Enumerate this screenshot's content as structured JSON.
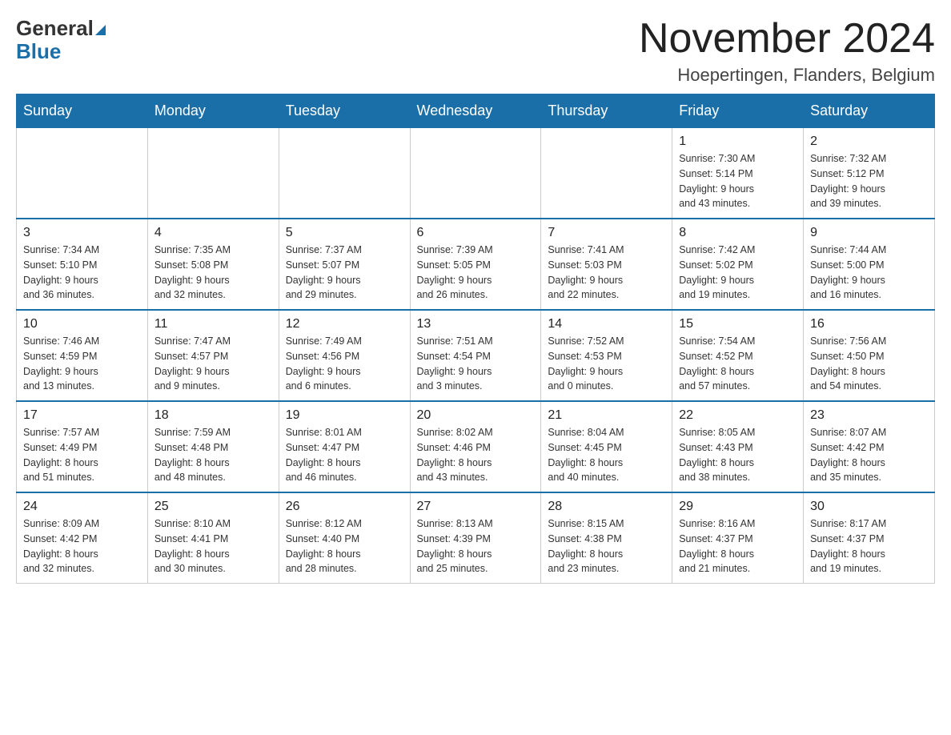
{
  "header": {
    "month_year": "November 2024",
    "location": "Hoepertingen, Flanders, Belgium",
    "logo_general": "General",
    "logo_blue": "Blue"
  },
  "days_of_week": [
    "Sunday",
    "Monday",
    "Tuesday",
    "Wednesday",
    "Thursday",
    "Friday",
    "Saturday"
  ],
  "weeks": [
    {
      "days": [
        {
          "num": "",
          "info": ""
        },
        {
          "num": "",
          "info": ""
        },
        {
          "num": "",
          "info": ""
        },
        {
          "num": "",
          "info": ""
        },
        {
          "num": "",
          "info": ""
        },
        {
          "num": "1",
          "info": "Sunrise: 7:30 AM\nSunset: 5:14 PM\nDaylight: 9 hours\nand 43 minutes."
        },
        {
          "num": "2",
          "info": "Sunrise: 7:32 AM\nSunset: 5:12 PM\nDaylight: 9 hours\nand 39 minutes."
        }
      ]
    },
    {
      "days": [
        {
          "num": "3",
          "info": "Sunrise: 7:34 AM\nSunset: 5:10 PM\nDaylight: 9 hours\nand 36 minutes."
        },
        {
          "num": "4",
          "info": "Sunrise: 7:35 AM\nSunset: 5:08 PM\nDaylight: 9 hours\nand 32 minutes."
        },
        {
          "num": "5",
          "info": "Sunrise: 7:37 AM\nSunset: 5:07 PM\nDaylight: 9 hours\nand 29 minutes."
        },
        {
          "num": "6",
          "info": "Sunrise: 7:39 AM\nSunset: 5:05 PM\nDaylight: 9 hours\nand 26 minutes."
        },
        {
          "num": "7",
          "info": "Sunrise: 7:41 AM\nSunset: 5:03 PM\nDaylight: 9 hours\nand 22 minutes."
        },
        {
          "num": "8",
          "info": "Sunrise: 7:42 AM\nSunset: 5:02 PM\nDaylight: 9 hours\nand 19 minutes."
        },
        {
          "num": "9",
          "info": "Sunrise: 7:44 AM\nSunset: 5:00 PM\nDaylight: 9 hours\nand 16 minutes."
        }
      ]
    },
    {
      "days": [
        {
          "num": "10",
          "info": "Sunrise: 7:46 AM\nSunset: 4:59 PM\nDaylight: 9 hours\nand 13 minutes."
        },
        {
          "num": "11",
          "info": "Sunrise: 7:47 AM\nSunset: 4:57 PM\nDaylight: 9 hours\nand 9 minutes."
        },
        {
          "num": "12",
          "info": "Sunrise: 7:49 AM\nSunset: 4:56 PM\nDaylight: 9 hours\nand 6 minutes."
        },
        {
          "num": "13",
          "info": "Sunrise: 7:51 AM\nSunset: 4:54 PM\nDaylight: 9 hours\nand 3 minutes."
        },
        {
          "num": "14",
          "info": "Sunrise: 7:52 AM\nSunset: 4:53 PM\nDaylight: 9 hours\nand 0 minutes."
        },
        {
          "num": "15",
          "info": "Sunrise: 7:54 AM\nSunset: 4:52 PM\nDaylight: 8 hours\nand 57 minutes."
        },
        {
          "num": "16",
          "info": "Sunrise: 7:56 AM\nSunset: 4:50 PM\nDaylight: 8 hours\nand 54 minutes."
        }
      ]
    },
    {
      "days": [
        {
          "num": "17",
          "info": "Sunrise: 7:57 AM\nSunset: 4:49 PM\nDaylight: 8 hours\nand 51 minutes."
        },
        {
          "num": "18",
          "info": "Sunrise: 7:59 AM\nSunset: 4:48 PM\nDaylight: 8 hours\nand 48 minutes."
        },
        {
          "num": "19",
          "info": "Sunrise: 8:01 AM\nSunset: 4:47 PM\nDaylight: 8 hours\nand 46 minutes."
        },
        {
          "num": "20",
          "info": "Sunrise: 8:02 AM\nSunset: 4:46 PM\nDaylight: 8 hours\nand 43 minutes."
        },
        {
          "num": "21",
          "info": "Sunrise: 8:04 AM\nSunset: 4:45 PM\nDaylight: 8 hours\nand 40 minutes."
        },
        {
          "num": "22",
          "info": "Sunrise: 8:05 AM\nSunset: 4:43 PM\nDaylight: 8 hours\nand 38 minutes."
        },
        {
          "num": "23",
          "info": "Sunrise: 8:07 AM\nSunset: 4:42 PM\nDaylight: 8 hours\nand 35 minutes."
        }
      ]
    },
    {
      "days": [
        {
          "num": "24",
          "info": "Sunrise: 8:09 AM\nSunset: 4:42 PM\nDaylight: 8 hours\nand 32 minutes."
        },
        {
          "num": "25",
          "info": "Sunrise: 8:10 AM\nSunset: 4:41 PM\nDaylight: 8 hours\nand 30 minutes."
        },
        {
          "num": "26",
          "info": "Sunrise: 8:12 AM\nSunset: 4:40 PM\nDaylight: 8 hours\nand 28 minutes."
        },
        {
          "num": "27",
          "info": "Sunrise: 8:13 AM\nSunset: 4:39 PM\nDaylight: 8 hours\nand 25 minutes."
        },
        {
          "num": "28",
          "info": "Sunrise: 8:15 AM\nSunset: 4:38 PM\nDaylight: 8 hours\nand 23 minutes."
        },
        {
          "num": "29",
          "info": "Sunrise: 8:16 AM\nSunset: 4:37 PM\nDaylight: 8 hours\nand 21 minutes."
        },
        {
          "num": "30",
          "info": "Sunrise: 8:17 AM\nSunset: 4:37 PM\nDaylight: 8 hours\nand 19 minutes."
        }
      ]
    }
  ]
}
